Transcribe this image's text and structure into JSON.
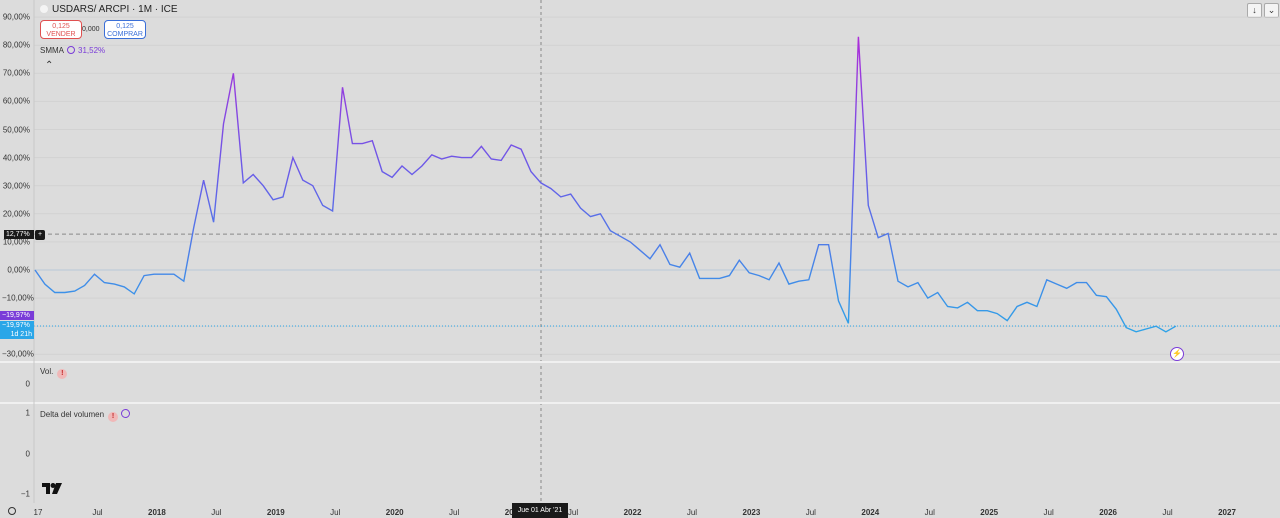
{
  "header": {
    "title": "USDARS/ ARCPI · 1M · ICE",
    "sell": {
      "price": "0,125",
      "label": "VENDER"
    },
    "spread": "0,000",
    "buy": {
      "price": "0,125",
      "label": "COMPRAR"
    },
    "indicator_name": "SMMA",
    "indicator_value": "31,52%"
  },
  "panes": {
    "volume_label": "Vol.",
    "delta_label": "Delta del volumen",
    "warn_glyph": "!"
  },
  "price_tags": {
    "last": "12,77%",
    "smma": "−19,97%",
    "price": "−19,97%",
    "countdown": "1d 21h"
  },
  "cursor_label": "Jue 01 Abr '21",
  "chart_data": {
    "type": "line",
    "y_axis_labels": [
      "90,00%",
      "80,00%",
      "70,00%",
      "60,00%",
      "50,00%",
      "40,00%",
      "30,00%",
      "20,00%",
      "10,00%",
      "0,00%",
      "−10,00%",
      "−20,00%",
      "−30,00%"
    ],
    "ylim": [
      -32,
      92
    ],
    "x_axis_labels": [
      "17",
      "Jul",
      "2018",
      "Jul",
      "2019",
      "Jul",
      "2020",
      "Jul",
      "2021",
      "Jul",
      "2022",
      "Jul",
      "2023",
      "Jul",
      "2024",
      "Jul",
      "2025",
      "Jul",
      "2026",
      "Jul",
      "2027"
    ],
    "xlim": [
      2017.0,
      2027.3
    ],
    "volume_pane_ticks": [
      "0"
    ],
    "delta_pane_ticks": [
      "1",
      "0",
      "−1"
    ],
    "reference_line": 12.77,
    "series": [
      {
        "values": [
          [
            2017.0,
            0
          ],
          [
            2017.1,
            -5
          ],
          [
            2017.2,
            -8
          ],
          [
            2017.3,
            -8
          ],
          [
            2017.4,
            -7.5
          ],
          [
            2017.5,
            -5.5
          ],
          [
            2017.6,
            -1.5
          ],
          [
            2017.7,
            -4.5
          ],
          [
            2017.8,
            -5
          ],
          [
            2017.9,
            -6
          ],
          [
            2018.0,
            -8.5
          ],
          [
            2018.1,
            -2
          ],
          [
            2018.2,
            -1.5
          ],
          [
            2018.3,
            -1.5
          ],
          [
            2018.4,
            -1.5
          ],
          [
            2018.5,
            -4
          ],
          [
            2018.6,
            15
          ],
          [
            2018.7,
            32
          ],
          [
            2018.8,
            17
          ],
          [
            2018.9,
            52
          ],
          [
            2019.0,
            70
          ],
          [
            2019.1,
            31
          ],
          [
            2019.2,
            34
          ],
          [
            2019.3,
            30
          ],
          [
            2019.4,
            25
          ],
          [
            2019.5,
            26
          ],
          [
            2019.6,
            40
          ],
          [
            2019.7,
            32
          ],
          [
            2019.8,
            30
          ],
          [
            2019.9,
            23
          ],
          [
            2020.0,
            21
          ],
          [
            2020.1,
            65
          ],
          [
            2020.2,
            45
          ],
          [
            2020.3,
            45
          ],
          [
            2020.4,
            46
          ],
          [
            2020.5,
            35
          ],
          [
            2020.6,
            33
          ],
          [
            2020.7,
            37
          ],
          [
            2020.8,
            34
          ],
          [
            2020.9,
            37
          ],
          [
            2021.0,
            41
          ],
          [
            2021.1,
            39.5
          ],
          [
            2021.2,
            40.5
          ],
          [
            2021.3,
            40
          ],
          [
            2021.4,
            40
          ],
          [
            2021.5,
            44
          ],
          [
            2021.6,
            39.5
          ],
          [
            2021.7,
            39
          ],
          [
            2021.8,
            44.5
          ],
          [
            2021.9,
            43
          ],
          [
            2022.0,
            35
          ],
          [
            2022.1,
            31
          ],
          [
            2022.2,
            29
          ],
          [
            2022.3,
            26
          ],
          [
            2022.4,
            27
          ],
          [
            2022.5,
            22
          ],
          [
            2022.6,
            19
          ],
          [
            2022.7,
            20
          ],
          [
            2022.8,
            14
          ],
          [
            2022.9,
            12
          ],
          [
            2023.0,
            10
          ],
          [
            2023.1,
            7
          ],
          [
            2023.2,
            4
          ],
          [
            2023.3,
            9
          ],
          [
            2023.4,
            2
          ],
          [
            2023.5,
            1
          ],
          [
            2023.6,
            6
          ],
          [
            2023.7,
            -3
          ],
          [
            2023.8,
            -3
          ],
          [
            2023.9,
            -3
          ],
          [
            2024.0,
            -2
          ],
          [
            2024.1,
            3.5
          ],
          [
            2024.2,
            -1
          ],
          [
            2024.3,
            -2
          ],
          [
            2024.4,
            -3.5
          ],
          [
            2024.5,
            2.5
          ],
          [
            2024.6,
            -5
          ],
          [
            2024.7,
            -4
          ],
          [
            2024.8,
            -3.5
          ],
          [
            2024.9,
            9
          ],
          [
            2025.0,
            9
          ],
          [
            2025.1,
            -11
          ],
          [
            2025.2,
            -19
          ],
          [
            2025.3,
            83
          ],
          [
            2025.4,
            23
          ],
          [
            2025.5,
            11.5
          ],
          [
            2025.6,
            13
          ],
          [
            2025.7,
            -4
          ],
          [
            2025.8,
            -6
          ],
          [
            2025.9,
            -4.5
          ],
          [
            2026.0,
            -10
          ],
          [
            2026.1,
            -8
          ],
          [
            2026.2,
            -13
          ],
          [
            2026.3,
            -13.5
          ],
          [
            2026.4,
            -11.5
          ],
          [
            2026.5,
            -14.5
          ],
          [
            2026.6,
            -14.5
          ],
          [
            2026.7,
            -15.5
          ],
          [
            2026.8,
            -18
          ],
          [
            2026.9,
            -13
          ],
          [
            2027.0,
            -11.5
          ],
          [
            2027.1,
            -13
          ],
          [
            2027.2,
            -3.5
          ],
          [
            2027.3,
            -5
          ],
          [
            2027.4,
            -6.5
          ],
          [
            2027.5,
            -4.5
          ],
          [
            2027.6,
            -4.5
          ],
          [
            2027.7,
            -9
          ],
          [
            2027.8,
            -9.5
          ],
          [
            2027.9,
            -14
          ],
          [
            2028.0,
            -20.5
          ],
          [
            2028.1,
            -22
          ],
          [
            2028.2,
            -21
          ],
          [
            2028.3,
            -20
          ],
          [
            2028.4,
            -22
          ],
          [
            2028.5,
            -20
          ]
        ]
      }
    ],
    "colors": {
      "line_low": "#2aa6e8",
      "line_high": "#9a2fe0",
      "smma": "#7a3cd8"
    }
  }
}
